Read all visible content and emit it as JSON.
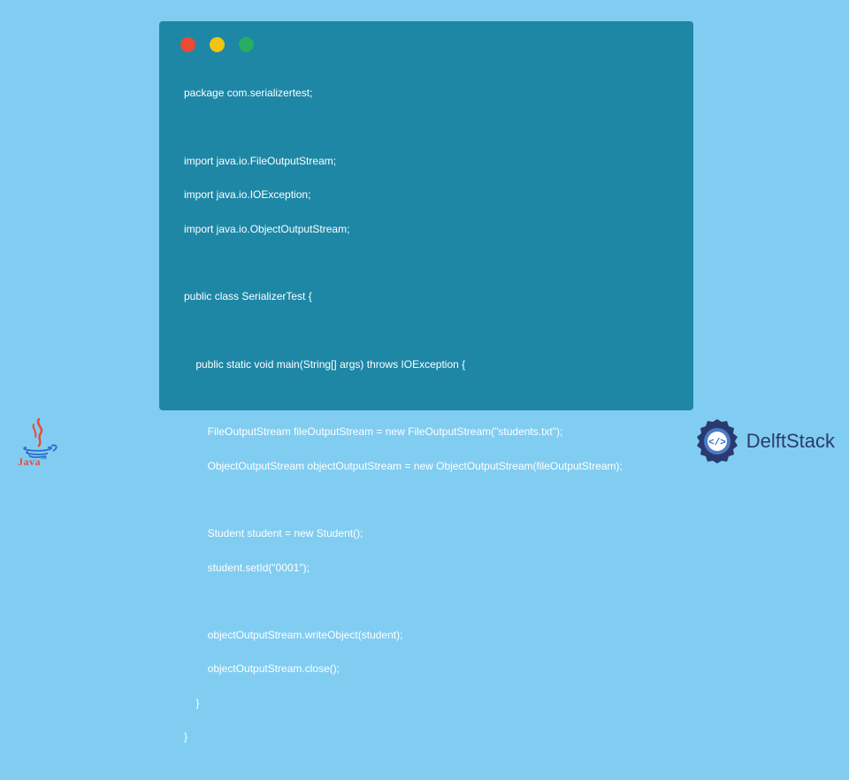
{
  "window": {
    "controls": [
      "red",
      "yellow",
      "green"
    ]
  },
  "code": {
    "l1": "package com.serializertest;",
    "l2": "import java.io.FileOutputStream;",
    "l3": "import java.io.IOException;",
    "l4": "import java.io.ObjectOutputStream;",
    "l5": "public class SerializerTest {",
    "l6": "    public static void main(String[] args) throws IOException {",
    "l7": "        FileOutputStream fileOutputStream = new FileOutputStream(\"students.txt\");",
    "l8": "        ObjectOutputStream objectOutputStream = new ObjectOutputStream(fileOutputStream);",
    "l9": "        Student student = new Student();",
    "l10": "        student.setId(\"0001\");",
    "l11": "        objectOutputStream.writeObject(student);",
    "l12": "        objectOutputStream.close();",
    "l13": "    }",
    "l14": "}"
  },
  "logos": {
    "java": "Java",
    "delft": "DelftStack"
  },
  "colors": {
    "background": "#81cdf2",
    "window": "#1e87a6",
    "text": "#ffffff",
    "delft_blue": "#2a3a6e",
    "java_red": "#e94b35"
  }
}
